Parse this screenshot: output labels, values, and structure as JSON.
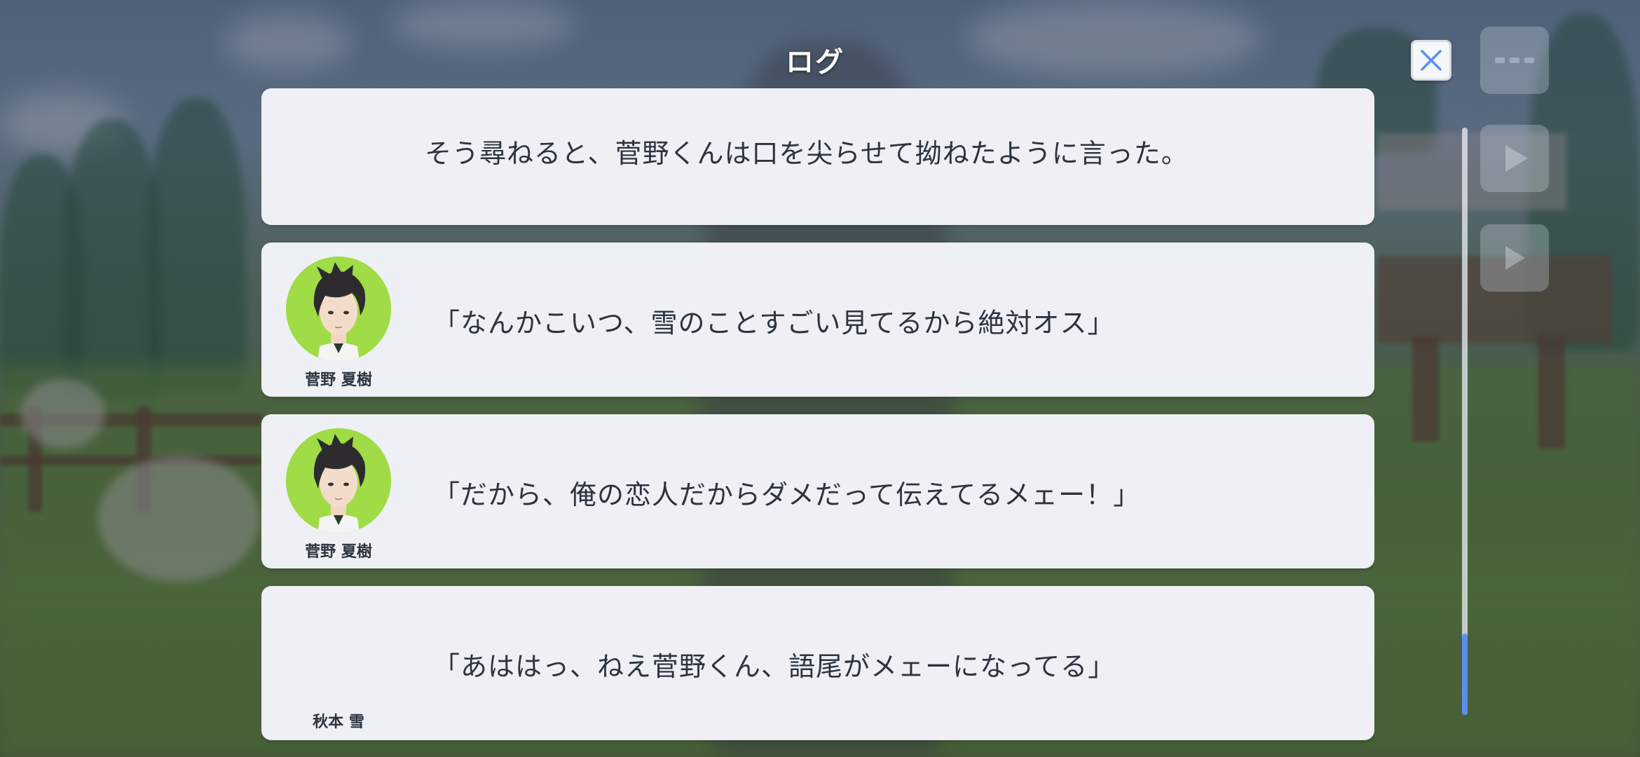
{
  "header": {
    "title": "ログ"
  },
  "log_entries": [
    {
      "text": "そう尋ねると、菅野くんは口を尖らせて拗ねたように言った。",
      "speaker": ""
    },
    {
      "text": "「なんかこいつ、雪のことすごい見てるから絶対オス」",
      "speaker": "菅野 夏樹"
    },
    {
      "text": "「だから、俺の恋人だからダメだって伝えてるメェー！」",
      "speaker": "菅野 夏樹"
    },
    {
      "text": "「あははっ、ねえ菅野くん、語尾がメェーになってる」",
      "speaker": "秋本 雪"
    }
  ],
  "controls": {
    "close_icon": "close-icon",
    "side_buttons": [
      "menu-dots-icon",
      "play-icon",
      "skip-play-icon"
    ]
  },
  "scrollbar": {
    "position": 0.86
  },
  "colors": {
    "panel": "#eef0f5",
    "text": "#2c3440",
    "avatar_bg": "#9fdc45",
    "accent": "#5a8ff0"
  }
}
